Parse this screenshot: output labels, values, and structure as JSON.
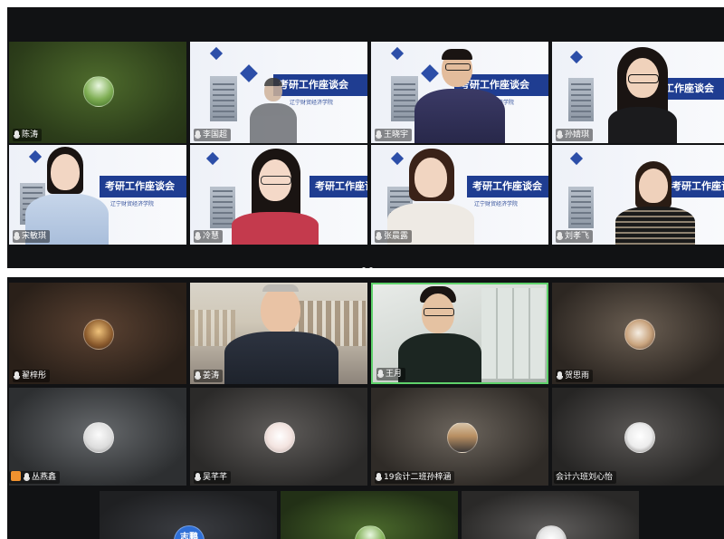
{
  "top_panel": {
    "participants": [
      {
        "name": "陈涛"
      },
      {
        "name": "李国超"
      },
      {
        "name": "王晓宇"
      },
      {
        "name": "孙婧琪"
      },
      {
        "name": "宋敏琪"
      },
      {
        "name": "冷慧"
      },
      {
        "name": "张晨露"
      },
      {
        "name": "刘孝飞"
      }
    ],
    "slide_title": "考研工作座谈会",
    "slide_subtitle": "辽宁财贸经济学院",
    "page_indicator": "• •"
  },
  "bottom_panel": {
    "participants": [
      {
        "name": "翟梓彤"
      },
      {
        "name": "姜涛"
      },
      {
        "name": "王月"
      },
      {
        "name": "贺思雨"
      },
      {
        "name": "丛燕鑫"
      },
      {
        "name": "吴芊芊"
      },
      {
        "name": "19会计二班孙梓涵"
      },
      {
        "name": "会计六班刘心怡"
      }
    ],
    "avatar_badge_text": "志鹏"
  },
  "colors": {
    "panel_bg": "#111214",
    "slide_band": "#1f3d91",
    "active_speaker_border": "#5fd16b"
  }
}
